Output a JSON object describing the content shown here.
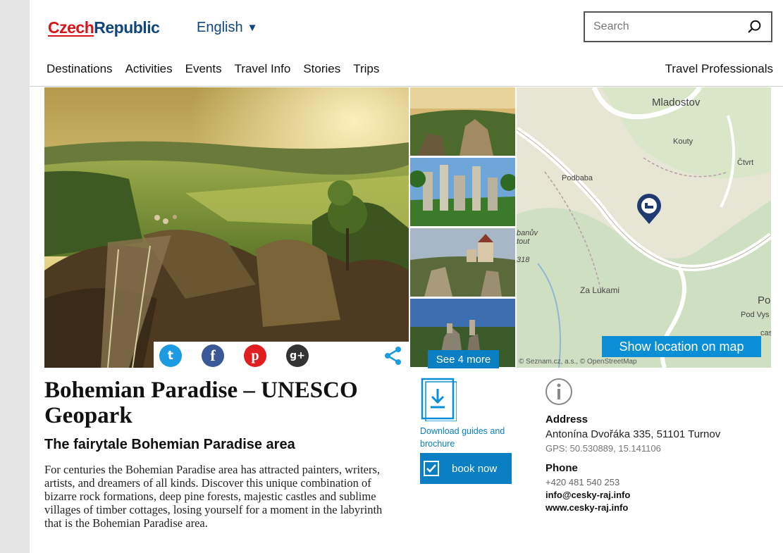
{
  "header": {
    "logo_part1": "Czech",
    "logo_part2": "Republic",
    "language": "English",
    "search_placeholder": "Search"
  },
  "nav": {
    "items": [
      "Destinations",
      "Activities",
      "Events",
      "Travel Info",
      "Stories",
      "Trips"
    ],
    "right": "Travel Professionals"
  },
  "gallery": {
    "see_more": "See 4 more",
    "share_icons": [
      "twitter-icon",
      "facebook-icon",
      "pinterest-icon",
      "google-plus-icon",
      "share-icon"
    ]
  },
  "map": {
    "labels": [
      "Mladostov",
      "Kouty",
      "Čtvrt",
      "Podbaba",
      "banův",
      "tout",
      "318",
      "Za Lukami",
      "Po",
      "Pod Vys",
      "cas"
    ],
    "attribution": "© Seznam.cz, a.s., © OpenStreetMap",
    "show_button": "Show location on map"
  },
  "content": {
    "title": "Bohemian Paradise – UNESCO Geopark",
    "subtitle": "The fairytale Bohemian Paradise area",
    "description": "For centuries the Bohemian Paradise area has attracted painters, writers, artists, and dreamers of all kinds. Discover this unique combination of bizarre rock formations, deep pine forests, majestic castles and sublime villages of timber cottages, losing yourself for a moment in the labyrinth that is the Bohemian Paradise area."
  },
  "actions": {
    "download": "Download guides and brochure",
    "book": "book now"
  },
  "info": {
    "address_heading": "Address",
    "address": "Antonína Dvořáka 335, 51101 Turnov",
    "gps": "GPS: 50.530889, 15.141106",
    "phone_heading": "Phone",
    "phone": "+420 481 540 253",
    "email": "info@cesky-raj.info",
    "website": "www.cesky-raj.info"
  },
  "colors": {
    "brand_red": "#d7141a",
    "brand_blue": "#11457e",
    "accent_blue": "#0a7fc3"
  }
}
